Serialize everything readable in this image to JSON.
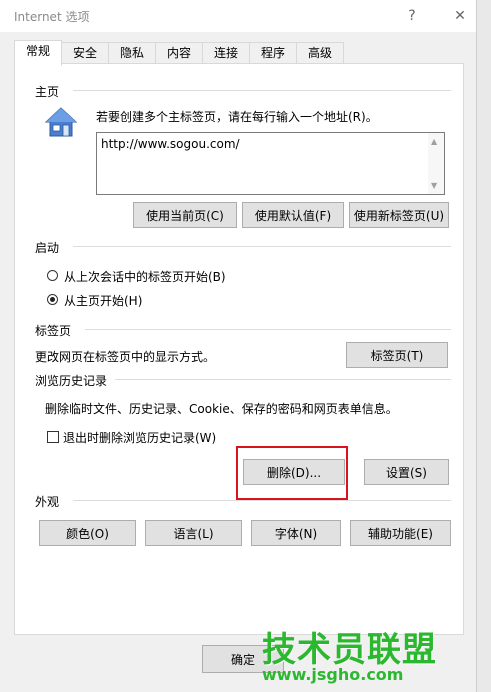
{
  "window": {
    "title": "Internet 选项",
    "help": "?",
    "close": "✕"
  },
  "tabs": [
    "常规",
    "安全",
    "隐私",
    "内容",
    "连接",
    "程序",
    "高级"
  ],
  "home": {
    "section": "主页",
    "instruction": "若要创建多个主标签页，请在每行输入一个地址(R)。",
    "url": "http://www.sogou.com/",
    "btn_current": "使用当前页(C)",
    "btn_default": "使用默认值(F)",
    "btn_newtab": "使用新标签页(U)"
  },
  "startup": {
    "section": "启动",
    "opt_last": "从上次会话中的标签页开始(B)",
    "opt_home": "从主页开始(H)",
    "selected": "opt_home"
  },
  "tabs_section": {
    "section": "标签页",
    "desc": "更改网页在标签页中的显示方式。",
    "btn": "标签页(T)"
  },
  "history": {
    "section": "浏览历史记录",
    "desc": "删除临时文件、历史记录、Cookie、保存的密码和网页表单信息。",
    "checkbox": "退出时删除浏览历史记录(W)",
    "btn_delete": "删除(D)...",
    "btn_settings": "设置(S)"
  },
  "appearance": {
    "section": "外观",
    "btn_colors": "颜色(O)",
    "btn_language": "语言(L)",
    "btn_fonts": "字体(N)",
    "btn_accessibility": "辅助功能(E)"
  },
  "footer": {
    "ok": "确定"
  },
  "watermark": {
    "text": "技术员联盟",
    "url": "www.jsgho.com"
  },
  "colors": {
    "highlight": "#d9141b",
    "watermark": "#2bb82f"
  }
}
